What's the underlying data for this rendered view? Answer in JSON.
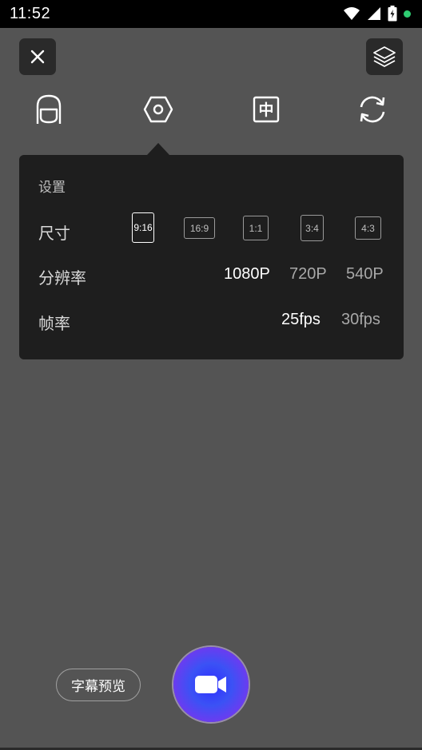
{
  "status_bar": {
    "time": "11:52",
    "icons": [
      "wifi-icon",
      "signal-icon",
      "battery-icon",
      "notification-dot-icon"
    ],
    "notification_color": "#2ecc71"
  },
  "top_bar": {
    "close_icon": "close-icon",
    "layers_icon": "layers-icon"
  },
  "toolbar": {
    "items": [
      {
        "icon": "face-outline-icon"
      },
      {
        "icon": "hexagon-settings-icon"
      },
      {
        "icon": "chinese-text-icon",
        "text": "中"
      },
      {
        "icon": "rotate-camera-icon"
      }
    ]
  },
  "settings": {
    "title": "设置",
    "size": {
      "label": "尺寸",
      "options": [
        "9:16",
        "16:9",
        "1:1",
        "3:4",
        "4:3"
      ],
      "selected": "9:16"
    },
    "resolution": {
      "label": "分辨率",
      "options": [
        "1080P",
        "720P",
        "540P"
      ],
      "selected": "1080P"
    },
    "framerate": {
      "label": "帧率",
      "options": [
        "25fps",
        "30fps"
      ],
      "selected": "25fps"
    }
  },
  "bottom": {
    "preview_label": "字幕预览",
    "record_icon": "video-camera-icon"
  }
}
